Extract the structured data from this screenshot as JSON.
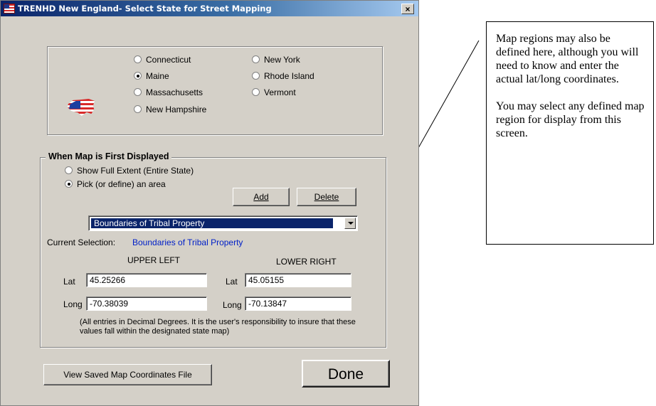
{
  "window": {
    "title": "TRENHD New England- Select State for Street Mapping",
    "close_label": "×",
    "icon": "app-flag-icon"
  },
  "states": {
    "flag_icon": "us-flag-map-icon",
    "options": [
      {
        "label": "Connecticut",
        "selected": false
      },
      {
        "label": "Maine",
        "selected": true
      },
      {
        "label": "Massachusetts",
        "selected": false
      },
      {
        "label": "New Hampshire",
        "selected": false
      },
      {
        "label": "New York",
        "selected": false
      },
      {
        "label": "Rhode Island",
        "selected": false
      },
      {
        "label": "Vermont",
        "selected": false
      }
    ]
  },
  "first_display": {
    "heading": "When Map is First Displayed",
    "show_full": {
      "label": "Show Full Extent (Entire State)",
      "selected": false
    },
    "pick_area": {
      "label": "Pick (or define) an area",
      "selected": true
    },
    "add_label": "Add",
    "delete_label": "Delete",
    "region_select": "Boundaries of Tribal Property",
    "current_selection_label": "Current Selection:",
    "current_selection_value": "Boundaries of Tribal Property"
  },
  "coords": {
    "upper_left_heading": "UPPER LEFT",
    "lower_right_heading": "LOWER RIGHT",
    "lat_label": "Lat",
    "long_label": "Long",
    "ul_lat": "45.25266",
    "ul_long": "-70.38039",
    "lr_lat": "45.05155",
    "lr_long": "-70.13847",
    "note": "(All entries in Decimal Degrees.  It is the user's responsibility to insure that these values fall within the designated state map)"
  },
  "footer": {
    "view_file_label": "View Saved Map Coordinates File",
    "done_label": "Done"
  },
  "annotation": {
    "para1": "Map regions may also be defined here, although you will need to know and enter the actual lat/long coordinates.",
    "para2": "You may select any defined map region for display from this screen."
  },
  "colors": {
    "title_bar": "#0a246a",
    "dialog_face": "#d4d0c8",
    "selection_highlight": "#0a246a",
    "current_selection_text": "#0020c8"
  }
}
